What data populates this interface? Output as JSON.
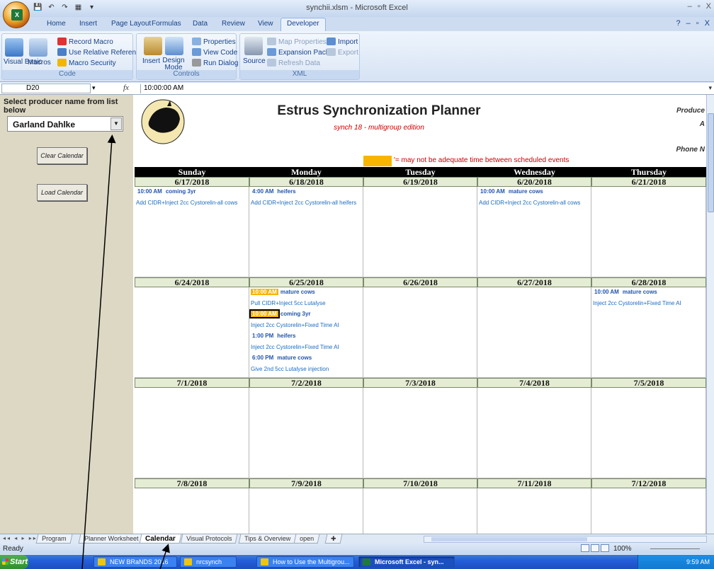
{
  "window": {
    "title": "synchii.xlsm - Microsoft Excel",
    "controls": [
      "–",
      "▫",
      "X"
    ],
    "app_controls": [
      "?",
      "–",
      "▫",
      "X"
    ]
  },
  "qat": [
    "💾",
    "↶",
    "↷",
    "▦",
    "▾"
  ],
  "ribbon": {
    "tabs": [
      "Home",
      "Insert",
      "Page Layout",
      "Formulas",
      "Data",
      "Review",
      "View",
      "Developer"
    ],
    "active_tab": "Developer",
    "groups": {
      "code": {
        "title": "Code",
        "visual_basic": "Visual Basic",
        "macros": "Macros",
        "record": "Record Macro",
        "relative": "Use Relative References",
        "security": "Macro Security"
      },
      "controls": {
        "title": "Controls",
        "insert": "Insert",
        "design": "Design Mode",
        "properties": "Properties",
        "view_code": "View Code",
        "run_dialog": "Run Dialog"
      },
      "xml": {
        "title": "XML",
        "source": "Source",
        "map_props": "Map Properties",
        "expansion": "Expansion Packs",
        "refresh": "Refresh Data",
        "import": "Import",
        "export": "Export"
      }
    }
  },
  "formula_bar": {
    "name_box": "D20",
    "fx": "fx",
    "value": "10:00:00 AM"
  },
  "left_panel": {
    "title": "Select producer name from list below",
    "producer": "Garland Dahlke",
    "clear": "Clear Calendar",
    "load": "Load Calendar"
  },
  "planner": {
    "title": "Estrus Synchronization Planner",
    "subtitle": "synch 18 - multigroup edition",
    "producer_label": "Produce",
    "producer_sub": "A",
    "phone_label": "Phone N",
    "legend_text": "'= may not be adequate  time between scheduled events",
    "colors": {
      "highlight": "#f7b500",
      "header_bg": "#000000",
      "date_bg": "#e4ecd3"
    }
  },
  "calendar": {
    "days": [
      "Sunday",
      "Monday",
      "Tuesday",
      "Wednesday",
      "Thursday"
    ],
    "weeks": [
      {
        "dates": [
          "6/17/2018",
          "6/18/2018",
          "6/19/2018",
          "6/20/2018",
          "6/21/2018"
        ],
        "cells": [
          [
            {
              "time": "10:00 AM",
              "group": "coming 3yr",
              "desc": "Add CIDR+Inject 2cc Cystorelin-all cows",
              "hl": ""
            }
          ],
          [
            {
              "time": "4:00 AM",
              "group": "heifers",
              "desc": "Add CIDR+Inject 2cc Cystorelin-all heifers",
              "hl": ""
            }
          ],
          [],
          [
            {
              "time": "10:00 AM",
              "group": "mature cows",
              "desc": "Add CIDR+Inject 2cc Cystorelin-all cows",
              "hl": ""
            }
          ],
          []
        ]
      },
      {
        "dates": [
          "6/24/2018",
          "6/25/2018",
          "6/26/2018",
          "6/27/2018",
          "6/28/2018"
        ],
        "cells": [
          [],
          [
            {
              "time": "10:00 AM",
              "group": "mature cows",
              "desc": "Pull CIDR+Inject 5cc Lutalyse",
              "hl": "hl"
            },
            {
              "time": "10:00 AM",
              "group": "coming 3yr",
              "desc": "Inject 2cc Cystorelin+Fixed Time AI",
              "hl": "sel"
            },
            {
              "time": "1:00 PM",
              "group": "heifers",
              "desc": "Inject 2cc Cystorelin+Fixed Time AI",
              "hl": ""
            },
            {
              "time": "6:00 PM",
              "group": "mature cows",
              "desc": "Give 2nd 5cc Lutalyse injection",
              "hl": ""
            }
          ],
          [],
          [],
          [
            {
              "time": "10:00 AM",
              "group": "mature cows",
              "desc": "Inject 2cc Cystorelin+Fixed Time AI",
              "hl": ""
            }
          ]
        ]
      },
      {
        "dates": [
          "7/1/2018",
          "7/2/2018",
          "7/3/2018",
          "7/4/2018",
          "7/5/2018"
        ],
        "cells": [
          [],
          [],
          [],
          [],
          []
        ]
      },
      {
        "dates": [
          "7/8/2018",
          "7/9/2018",
          "7/10/2018",
          "7/11/2018",
          "7/12/2018"
        ],
        "cells": [
          [],
          [],
          [],
          [],
          []
        ]
      }
    ]
  },
  "sheet_tabs": {
    "nav": "◂◂ ◂ ▸ ▸▸",
    "tabs": [
      "Program",
      "Planner Worksheet",
      "Calendar",
      "Visual Protocols",
      "Tips & Overview",
      "open"
    ],
    "active": "Calendar"
  },
  "status": {
    "ready": "Ready",
    "zoom": "100%"
  },
  "taskbar": {
    "start": "Start",
    "items": [
      "NEW BRaNDS 2016",
      "nrcsynch",
      "How to Use the Multigrou...",
      "Microsoft Excel - syn..."
    ],
    "time": "9:59 AM"
  }
}
